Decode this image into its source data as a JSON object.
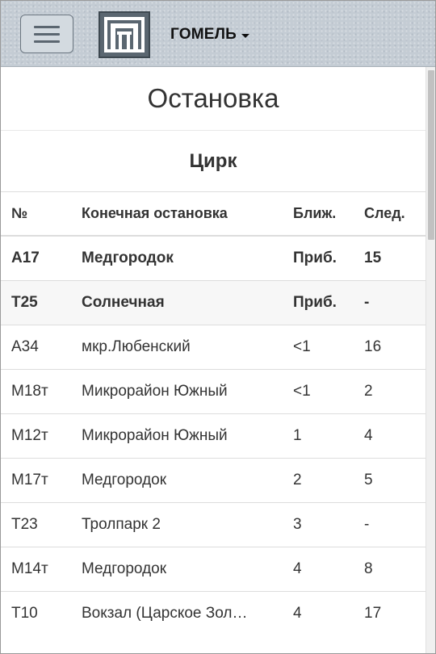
{
  "header": {
    "city": "ГОМЕЛЬ",
    "menu_icon": "hamburger-menu-icon",
    "logo_icon": "transport-logo-icon"
  },
  "page": {
    "title": "Остановка",
    "stop_name": "Цирк"
  },
  "table": {
    "columns": [
      "№",
      "Конечная остановка",
      "Ближ.",
      "След."
    ],
    "rows": [
      {
        "route": "А17",
        "destination": "Медгородок",
        "next": "Приб.",
        "following": "15"
      },
      {
        "route": "Т25",
        "destination": "Солнечная",
        "next": "Приб.",
        "following": "-"
      },
      {
        "route": "А34",
        "destination": "мкр.Любенский",
        "next": "<1",
        "following": "16"
      },
      {
        "route": "М18т",
        "destination": "Микрорайон Южный",
        "next": "<1",
        "following": "2"
      },
      {
        "route": "М12т",
        "destination": "Микрорайон Южный",
        "next": "1",
        "following": "4"
      },
      {
        "route": "М17т",
        "destination": "Медгородок",
        "next": "2",
        "following": "5"
      },
      {
        "route": "Т23",
        "destination": "Тролпарк 2",
        "next": "3",
        "following": "-"
      },
      {
        "route": "М14т",
        "destination": "Медгородок",
        "next": "4",
        "following": "8"
      },
      {
        "route": "Т10",
        "destination": "Вокзал (Царское Зол…",
        "next": "4",
        "following": "17"
      }
    ]
  },
  "colors": {
    "header_bg": "#c4ccd4",
    "logo_bg": "#5a6670",
    "row_stripe": "#f7f7f7"
  }
}
